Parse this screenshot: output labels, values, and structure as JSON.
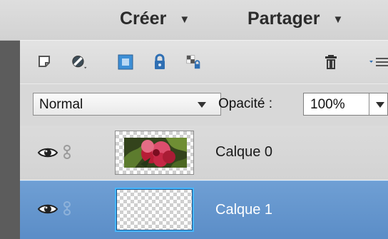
{
  "menu": {
    "create_label": "Créer",
    "share_label": "Partager"
  },
  "toolbar": {
    "icons": [
      "new-layer-icon",
      "adjustment-layer-icon",
      "mask-icon",
      "lock-icon",
      "lock-transparency-icon",
      "trash-icon",
      "panel-menu-icon"
    ]
  },
  "options": {
    "blend_mode": "Normal",
    "opacity_label": "Opacité :",
    "opacity_value": "100%"
  },
  "layers": [
    {
      "name": "Calque 0",
      "selected": false,
      "thumbnail": "rose-photo"
    },
    {
      "name": "Calque 1",
      "selected": true,
      "thumbnail": "transparent"
    }
  ],
  "colors": {
    "selected_row": "#5f92cc",
    "selection_border": "#45b7ff",
    "mask_icon": "#3d8fd6",
    "lock_icon": "#2f6fb3"
  }
}
